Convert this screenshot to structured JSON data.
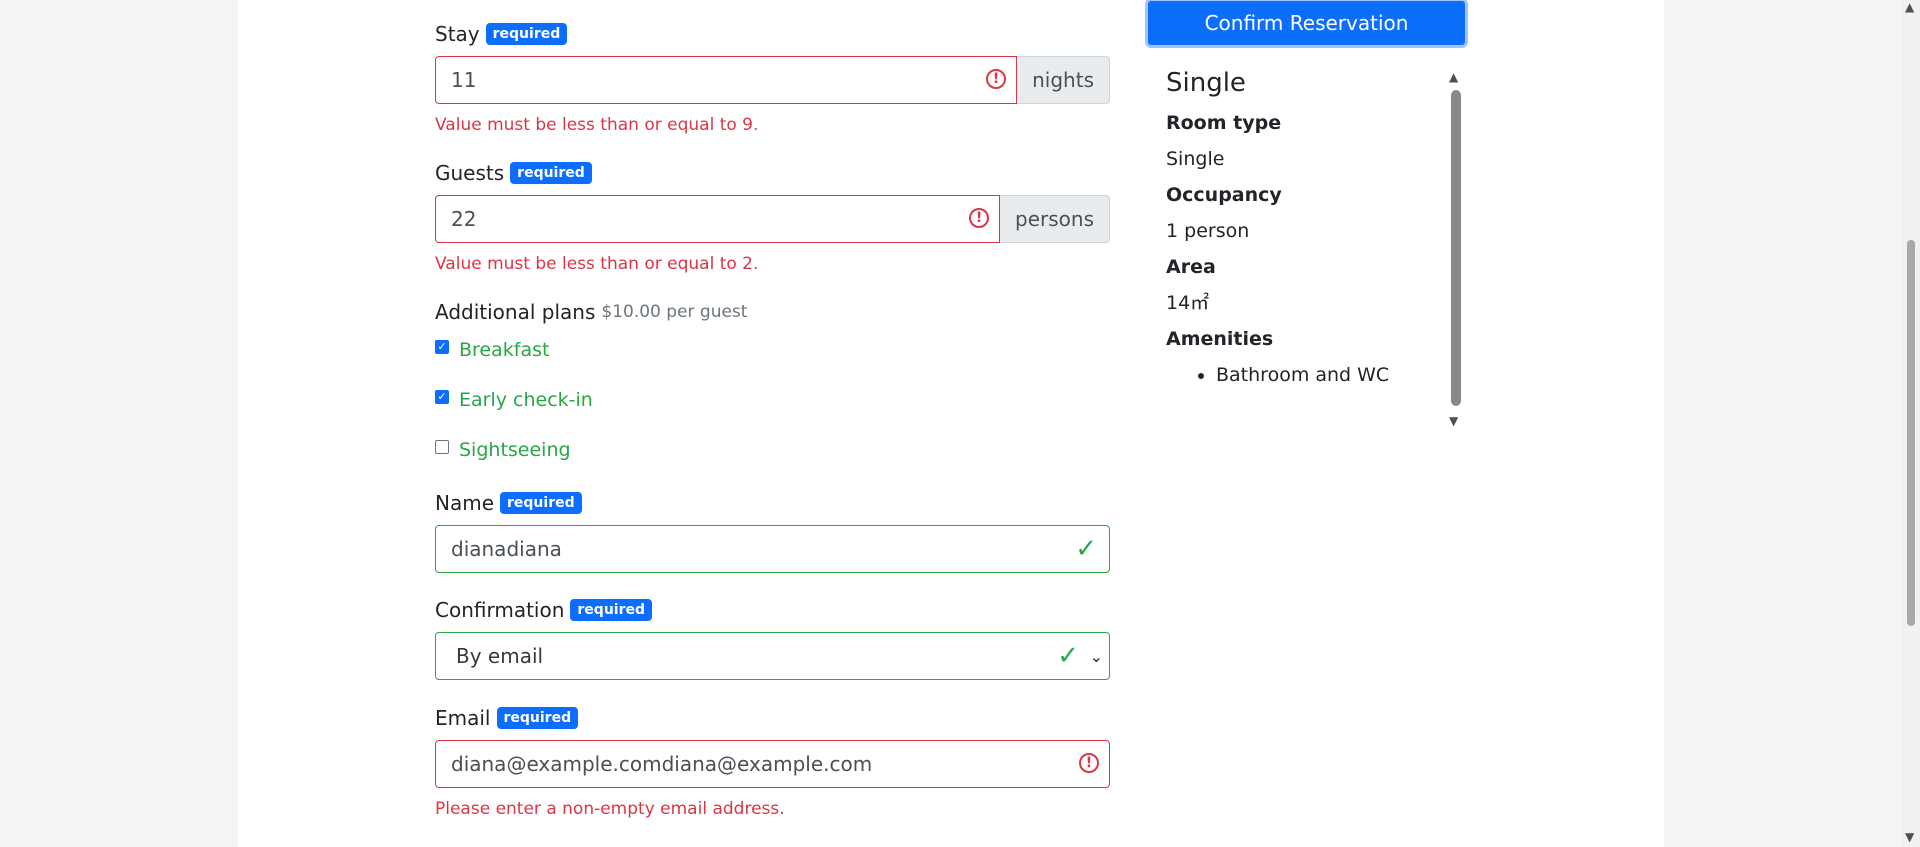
{
  "form": {
    "required_badge": "required",
    "stay": {
      "label": "Stay",
      "value": "11",
      "addon": "nights",
      "error": "Value must be less than or equal to 9."
    },
    "guests": {
      "label": "Guests",
      "value": "22",
      "addon": "persons",
      "error": "Value must be less than or equal to 2."
    },
    "plans": {
      "label": "Additional plans",
      "price_note": "$10.00 per guest",
      "options": [
        {
          "label": "Breakfast",
          "checked": true
        },
        {
          "label": "Early check-in",
          "checked": true
        },
        {
          "label": "Sightseeing",
          "checked": false
        }
      ]
    },
    "name": {
      "label": "Name",
      "value": "dianadiana"
    },
    "confirmation": {
      "label": "Confirmation",
      "value": "By email"
    },
    "email": {
      "label": "Email",
      "value": "diana@example.comdiana@example.com",
      "error": "Please enter a non-empty email address."
    }
  },
  "actions": {
    "confirm_label": "Confirm Reservation"
  },
  "room": {
    "title": "Single",
    "room_type_label": "Room type",
    "room_type": "Single",
    "occupancy_label": "Occupancy",
    "occupancy": "1 person",
    "area_label": "Area",
    "area": "14㎡",
    "amenities_label": "Amenities",
    "amenities": [
      "Bathroom and WC"
    ]
  },
  "colors": {
    "primary": "#0d6efd",
    "invalid": "#dc3545",
    "valid": "#28a745"
  }
}
